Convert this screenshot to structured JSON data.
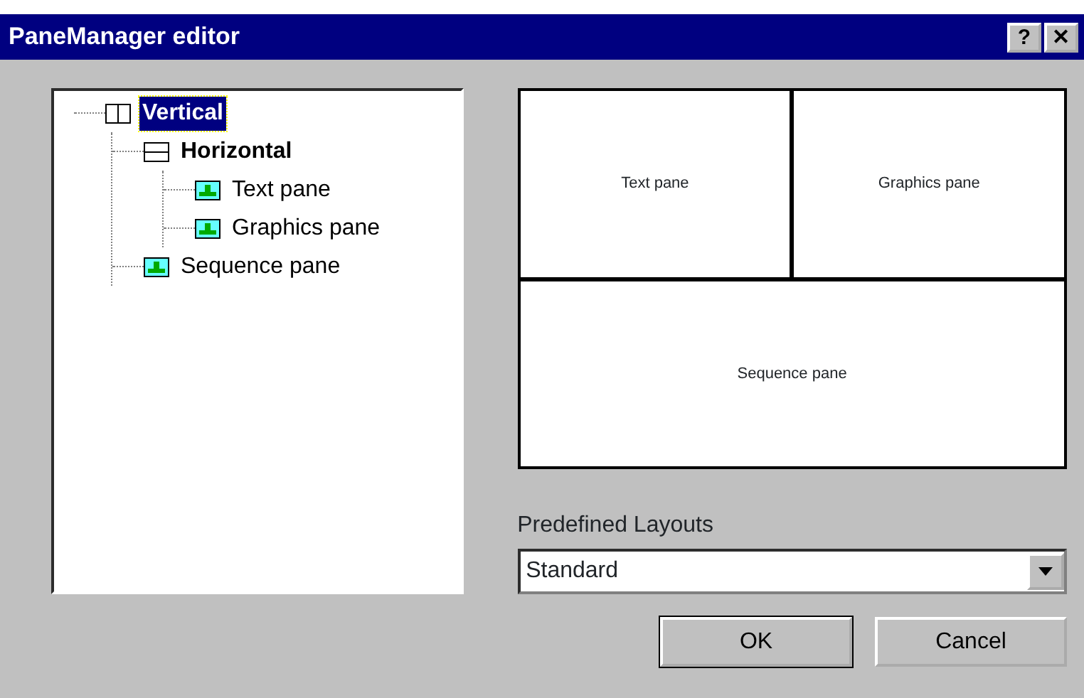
{
  "window": {
    "title": "PaneManager editor",
    "buttons": [
      "?",
      "✕"
    ]
  },
  "tree": [
    {
      "label": "Vertical",
      "kind": "vertical",
      "selected": true,
      "children": [
        {
          "label": "Horizontal",
          "kind": "horizontal",
          "selected": false,
          "children": [
            {
              "label": "Text pane",
              "kind": "pane",
              "selected": false
            },
            {
              "label": "Graphics pane",
              "kind": "pane",
              "selected": false
            }
          ]
        },
        {
          "label": "Sequence pane",
          "kind": "pane",
          "selected": false
        }
      ]
    }
  ],
  "preview": {
    "rows": [
      [
        "Text pane",
        "Graphics pane"
      ],
      [
        "Sequence pane"
      ]
    ]
  },
  "layouts": {
    "label": "Predefined Layouts",
    "value": "Standard"
  },
  "buttons": [
    {
      "label": "OK",
      "default": true
    },
    {
      "label": "Cancel",
      "default": false
    }
  ]
}
